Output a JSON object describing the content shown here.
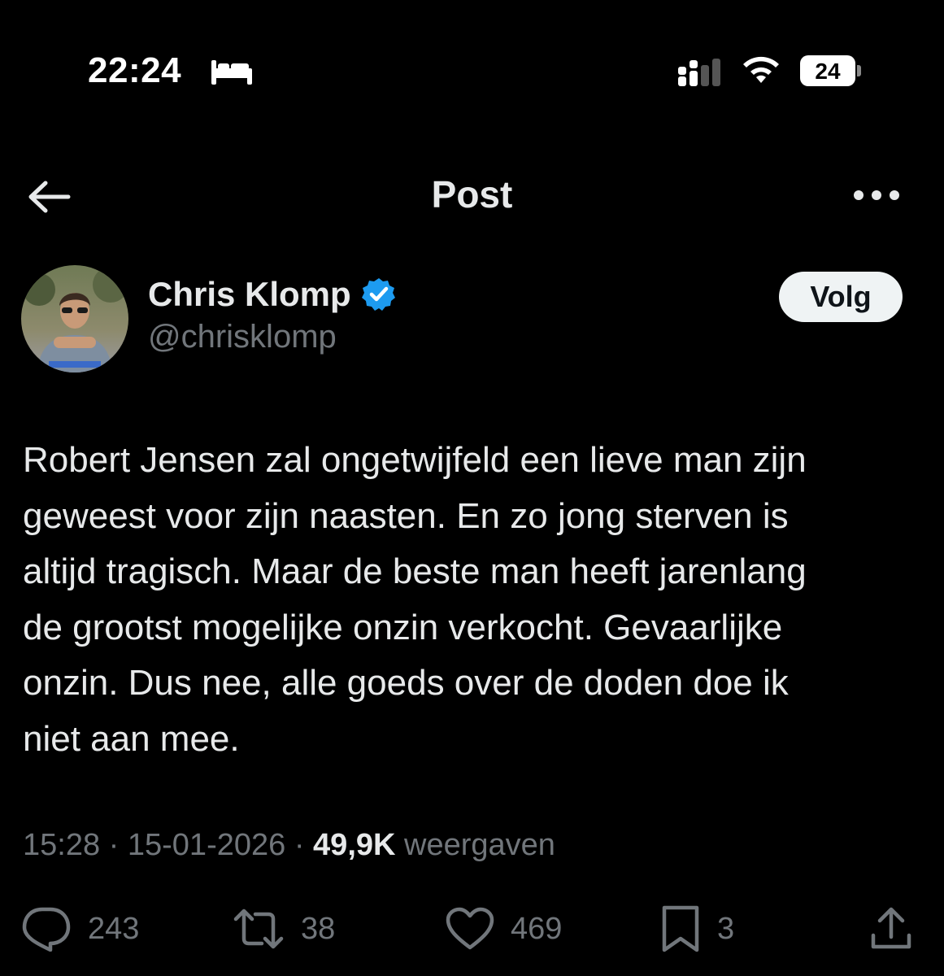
{
  "status_bar": {
    "time": "22:24",
    "battery": "24",
    "icons": [
      "bed-icon",
      "signal-icon",
      "wifi-icon",
      "battery-icon"
    ]
  },
  "header": {
    "title": "Post",
    "back_icon": "arrow-left-icon",
    "more_icon": "more-horizontal-icon"
  },
  "author": {
    "name": "Chris Klomp",
    "handle": "@chrisklomp",
    "verified": true,
    "verified_color": "#1d9bf0",
    "follow_label": "Volg"
  },
  "post": {
    "lines": [
      "Robert Jensen zal ongetwijfeld een lieve man zijn",
      "geweest voor zijn naasten. En zo jong sterven is",
      "altijd tragisch. Maar de beste man heeft jarenlang",
      "de grootst mogelijke onzin verkocht. Gevaarlijke",
      "onzin. Dus nee, alle goeds over de doden doe ik",
      "niet aan mee."
    ]
  },
  "meta": {
    "time": "15:28",
    "separator": " · ",
    "date": "15-01-2026",
    "views_count": "49,9K",
    "views_label": "weergaven"
  },
  "actions": {
    "replies": "243",
    "reposts": "38",
    "likes": "469",
    "bookmarks": "3"
  },
  "colors": {
    "background": "#000000",
    "text": "#e7e9ea",
    "muted": "#71767b",
    "button_bg": "#eff3f4",
    "accent": "#1d9bf0"
  }
}
